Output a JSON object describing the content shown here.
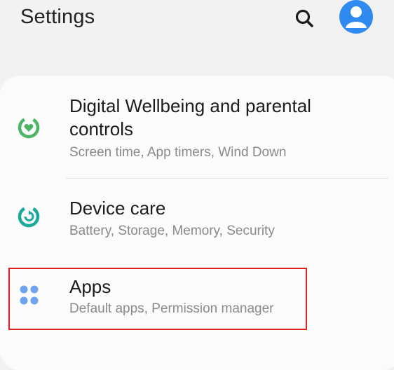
{
  "header": {
    "title": "Settings"
  },
  "icons": {
    "search": "search-icon",
    "account": "account-icon"
  },
  "colors": {
    "accent": "#2f8bf0",
    "wellbeing": "#4cb664",
    "device_care": "#1aa99a",
    "apps": "#6ea4ee",
    "highlight_box": "#e02020"
  },
  "items": [
    {
      "label": "Digital Wellbeing and parental controls",
      "sub": "Screen time, App timers, Wind Down",
      "icon": "digital-wellbeing-icon"
    },
    {
      "label": "Device care",
      "sub": "Battery, Storage, Memory, Security",
      "icon": "device-care-icon"
    },
    {
      "label": "Apps",
      "sub": "Default apps, Permission manager",
      "icon": "apps-icon"
    }
  ]
}
